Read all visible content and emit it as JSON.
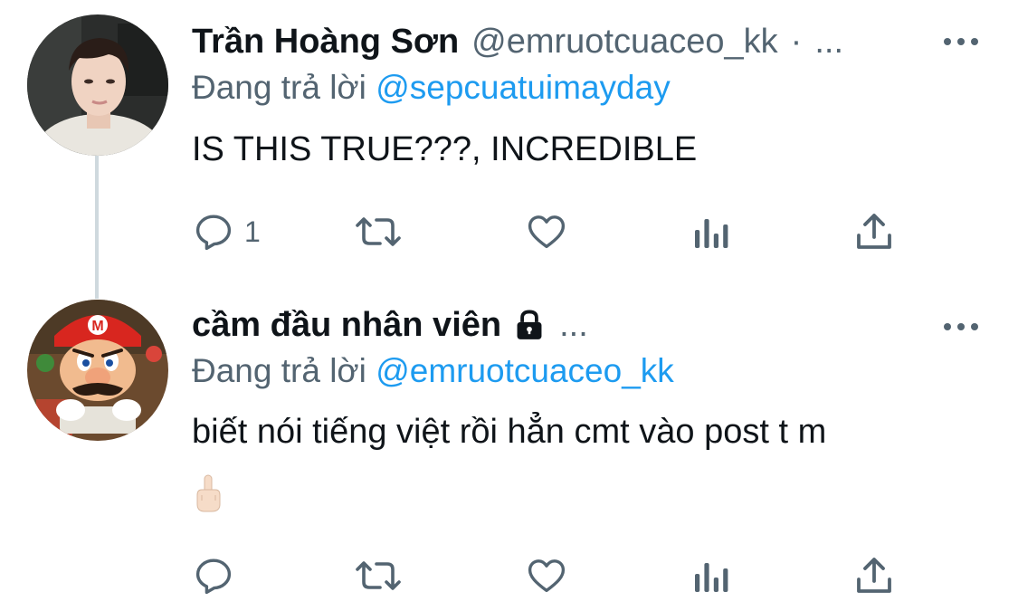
{
  "colors": {
    "text_primary": "#0f1419",
    "text_secondary": "#536471",
    "link": "#1d9bf0",
    "thread_line": "#cfd9de"
  },
  "tweets": [
    {
      "display_name": "Trần Hoàng Sơn",
      "handle": "@emruotcuaceo_kk",
      "separator": "·",
      "truncation": "...",
      "reply_prefix": "Đang trả lời",
      "reply_to": "@sepcuatuimayday",
      "text": "IS THIS TRUE???, INCREDIBLE",
      "reply_count": "1",
      "avatar": "avatar-photo",
      "icons": [
        "reply-icon",
        "retweet-icon",
        "like-icon",
        "views-icon",
        "share-icon",
        "more-icon"
      ]
    },
    {
      "display_name": "cầm đầu nhân viên",
      "truncation": "...",
      "locked": true,
      "reply_prefix": "Đang trả lời",
      "reply_to": "@emruotcuaceo_kk",
      "text": "biết nói tiếng việt rồi hẳn cmt vào post t m",
      "emoji": "🖕🏻",
      "avatar": "avatar-mario",
      "icons": [
        "lock-icon",
        "reply-icon",
        "retweet-icon",
        "like-icon",
        "views-icon",
        "share-icon",
        "more-icon"
      ]
    }
  ]
}
